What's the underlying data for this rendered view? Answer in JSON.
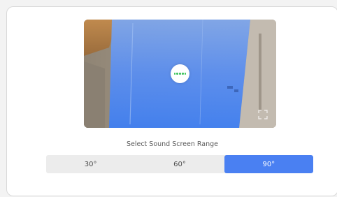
{
  "preview": {
    "loading_icon": "loading-dots-icon",
    "expand_icon": "expand-icon"
  },
  "caption": "Select Sound Screen Range",
  "range_options": [
    {
      "label": "30°",
      "selected": false
    },
    {
      "label": "60°",
      "selected": false
    },
    {
      "label": "90°",
      "selected": true
    }
  ],
  "colors": {
    "accent": "#4a80f2",
    "segment_background": "#ececec",
    "overlay_blue": "#3f7ff2",
    "loading_dot": "#3cc35a"
  }
}
